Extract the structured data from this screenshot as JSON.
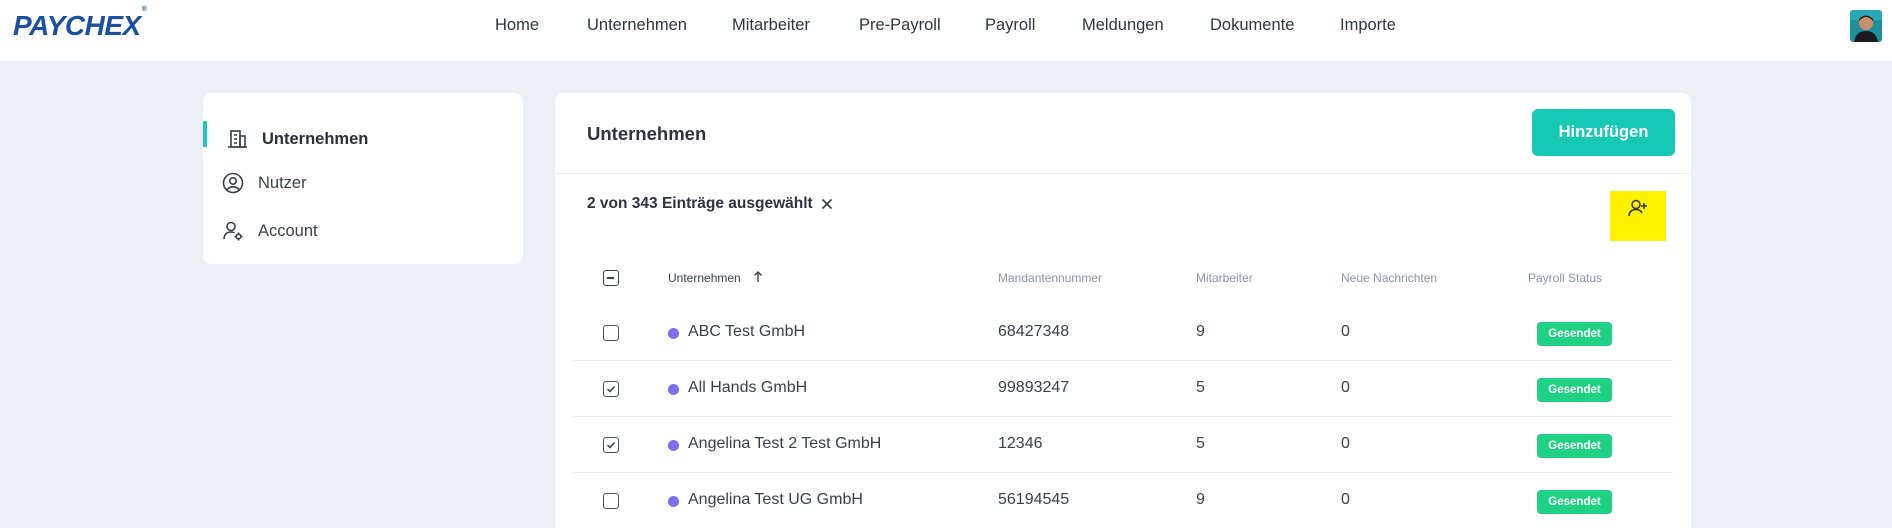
{
  "header": {
    "logo_text": "PAYCHEX",
    "logo_mark": "®",
    "nav": [
      "Home",
      "Unternehmen",
      "Mitarbeiter",
      "Pre-Payroll",
      "Payroll",
      "Meldungen",
      "Dokumente",
      "Importe"
    ]
  },
  "sidebar": {
    "items": [
      {
        "label": "Unternehmen",
        "icon": "building-icon",
        "active": true
      },
      {
        "label": "Nutzer",
        "icon": "user-circle-icon",
        "active": false
      },
      {
        "label": "Account",
        "icon": "user-settings-icon",
        "active": false
      }
    ]
  },
  "main": {
    "title": "Unternehmen",
    "add_button": "Hinzufügen",
    "selection_text": "2 von 343 Einträge ausgewählt",
    "columns": {
      "company": "Unternehmen",
      "client_number": "Mandantennummer",
      "employees": "Mitarbeiter",
      "new_messages": "Neue Nachrichten",
      "payroll_status": "Payroll Status"
    },
    "rows": [
      {
        "checked": false,
        "company": "ABC Test GmbH",
        "client_number": "68427348",
        "employees": "9",
        "new_messages": "0",
        "status": "Gesendet"
      },
      {
        "checked": true,
        "company": "All Hands GmbH",
        "client_number": "99893247",
        "employees": "5",
        "new_messages": "0",
        "status": "Gesendet"
      },
      {
        "checked": true,
        "company": "Angelina Test 2 Test GmbH",
        "client_number": "12346",
        "employees": "5",
        "new_messages": "0",
        "status": "Gesendet"
      },
      {
        "checked": false,
        "company": "Angelina Test UG GmbH",
        "client_number": "56194545",
        "employees": "9",
        "new_messages": "0",
        "status": "Gesendet"
      }
    ]
  },
  "colors": {
    "accent": "#15c9b5",
    "status_badge": "#1fd184",
    "highlight": "#fff200",
    "company_dot": "#7b6ff0",
    "logo": "#1b4fa0"
  }
}
